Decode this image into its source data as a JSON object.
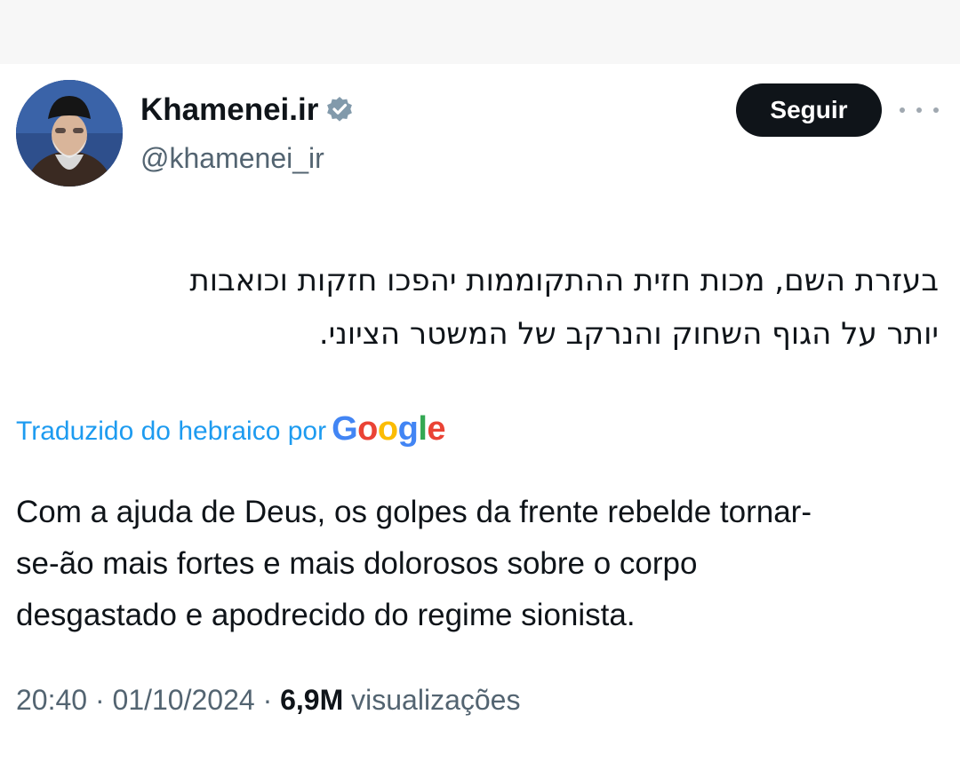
{
  "tweet": {
    "author": {
      "display_name": "Khamenei.ir",
      "handle": "@khamenei_ir",
      "verified": true
    },
    "follow_label": "Seguir",
    "more_icon": "more-horizontal-icon",
    "original_text_lines": [
      "בעזרת השם, מכות חזית ההתקוממות יהפכו חזקות וכואבות",
      "יותר על הגוף השחוק והנרקב של המשטר הציוני."
    ],
    "translation_label": "Traduzido do hebraico por",
    "translation_provider": "Google",
    "translated_text_lines": [
      "Com a ajuda de Deus, os golpes da frente rebelde tornar-",
      "se-ão mais fortes e mais dolorosos sobre o corpo",
      "desgastado e apodrecido do regime sionista."
    ],
    "time": "20:40",
    "separator": " · ",
    "date": "01/10/2024",
    "views_count": "6,9M",
    "views_label": " visualizações"
  },
  "colors": {
    "text_primary": "#0f1419",
    "text_secondary": "#536471",
    "link_blue": "#1d9bf0",
    "button_bg": "#0f1419",
    "button_text": "#ffffff",
    "verified_badge": "#829aab"
  }
}
